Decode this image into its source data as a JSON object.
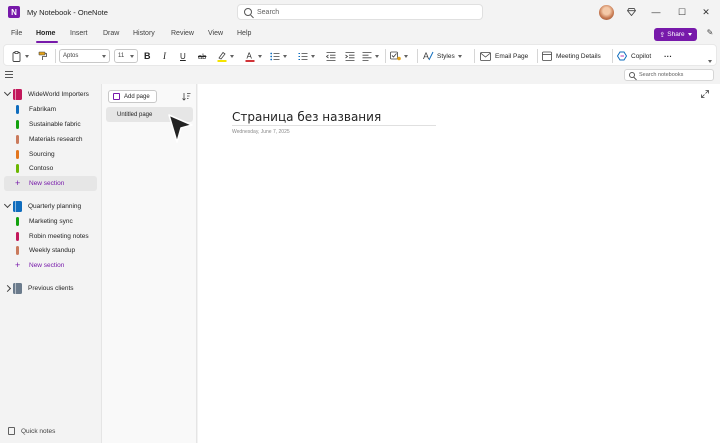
{
  "window": {
    "app_icon": "N",
    "title": "My Notebook - OneNote",
    "search_placeholder": "Search",
    "controls": [
      "—",
      "☐",
      "✕"
    ]
  },
  "menu": {
    "tabs": [
      "File",
      "Home",
      "Insert",
      "Draw",
      "History",
      "Review",
      "View",
      "Help"
    ],
    "active": "Home",
    "share_label": "Share"
  },
  "ribbon": {
    "font_name": "Aptos",
    "font_size": "11",
    "bold": "B",
    "italic": "I",
    "underline": "U",
    "strike": "ab",
    "styles_label": "Styles",
    "email_label": "Email Page",
    "meeting_label": "Meeting Details",
    "copilot_label": "Copilot",
    "more": "···",
    "highlight_color": "#f5e400",
    "font_color": "#d13438"
  },
  "search_notebooks": {
    "placeholder": "Search notebooks"
  },
  "notebooks": [
    {
      "name": "WideWorld Importers",
      "color": "#c2185b",
      "expanded": true,
      "sections": [
        {
          "name": "Fabrikam",
          "color": "#0f6cbd"
        },
        {
          "name": "Sustainable fabric",
          "color": "#13a10e"
        },
        {
          "name": "Materials research",
          "color": "#ca7a5c"
        },
        {
          "name": "Sourcing",
          "color": "#e3761d"
        },
        {
          "name": "Contoso",
          "color": "#6bb700"
        }
      ],
      "new_section": "New section"
    },
    {
      "name": "Quarterly planning",
      "color": "#0f6cbd",
      "expanded": true,
      "sections": [
        {
          "name": "Marketing sync",
          "color": "#13a10e"
        },
        {
          "name": "Robin meeting notes",
          "color": "#c2185b"
        },
        {
          "name": "Weekly standup",
          "color": "#ca7a5c"
        }
      ],
      "new_section": "New section"
    },
    {
      "name": "Previous clients",
      "color": "#6b7b8c",
      "expanded": false
    }
  ],
  "quick_notes": "Quick notes",
  "pages": {
    "add_page": "Add page",
    "items": [
      "Untitled page"
    ]
  },
  "page": {
    "title": "Страница без названия",
    "date": "Wednesday, June 7, 2025"
  },
  "accent": "#7719aa"
}
